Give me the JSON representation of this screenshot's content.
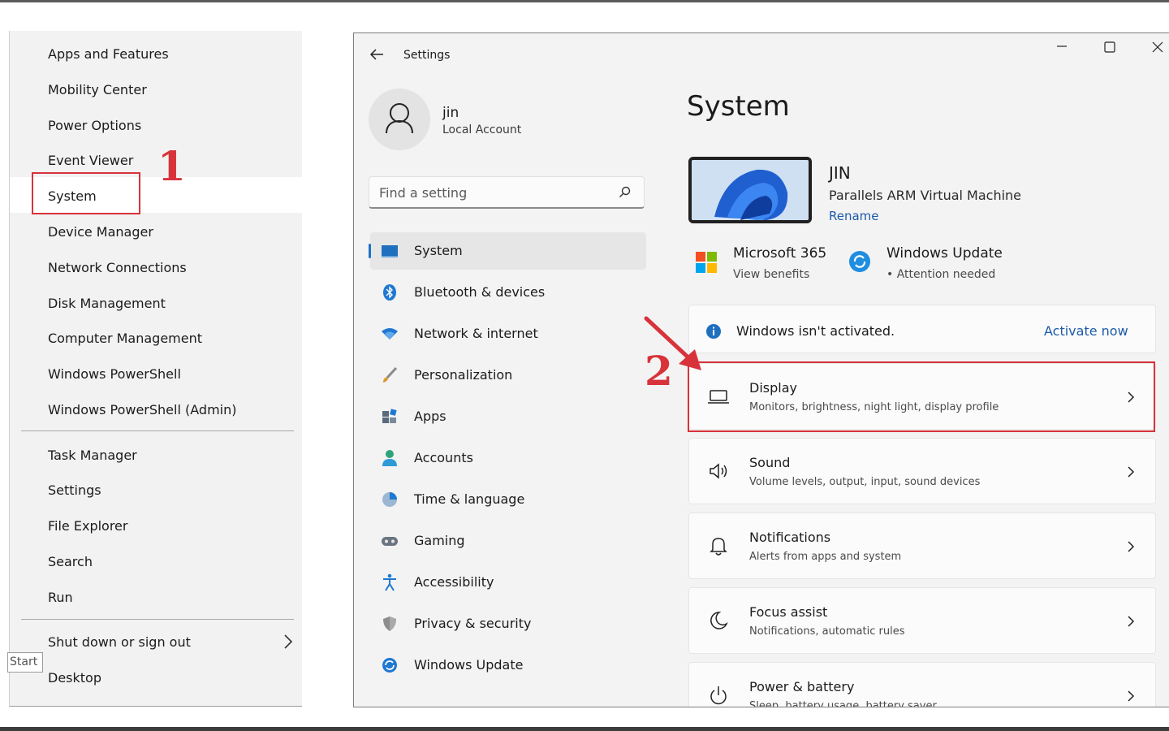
{
  "winx_menu": {
    "items": [
      "Apps and Features",
      "Mobility Center",
      "Power Options",
      "Event Viewer",
      "System",
      "Device Manager",
      "Network Connections",
      "Disk Management",
      "Computer Management",
      "Windows PowerShell",
      "Windows PowerShell (Admin)",
      "Task Manager",
      "Settings",
      "File Explorer",
      "Search",
      "Run",
      "Shut down or sign out",
      "Desktop"
    ],
    "highlighted": "System",
    "start_tooltip": "Start"
  },
  "annotations": {
    "step1": "1",
    "step2": "2",
    "color": "#d8323a"
  },
  "settings": {
    "window_title": "Settings",
    "user": {
      "name": "jin",
      "account_type": "Local Account"
    },
    "search": {
      "placeholder": "Find a setting"
    },
    "nav": [
      {
        "label": "System",
        "icon": "monitor-icon",
        "selected": true
      },
      {
        "label": "Bluetooth & devices",
        "icon": "bluetooth-icon"
      },
      {
        "label": "Network & internet",
        "icon": "wifi-icon"
      },
      {
        "label": "Personalization",
        "icon": "brush-icon"
      },
      {
        "label": "Apps",
        "icon": "apps-icon"
      },
      {
        "label": "Accounts",
        "icon": "person-icon"
      },
      {
        "label": "Time & language",
        "icon": "globe-clock-icon"
      },
      {
        "label": "Gaming",
        "icon": "gamepad-icon"
      },
      {
        "label": "Accessibility",
        "icon": "accessibility-icon"
      },
      {
        "label": "Privacy & security",
        "icon": "shield-icon"
      },
      {
        "label": "Windows Update",
        "icon": "update-icon"
      }
    ],
    "page_title": "System",
    "device": {
      "name": "JIN",
      "model": "Parallels ARM Virtual Machine",
      "rename": "Rename"
    },
    "quick_links": [
      {
        "title": "Microsoft 365",
        "subtitle": "View benefits",
        "icon": "microsoft-logo-icon"
      },
      {
        "title": "Windows Update",
        "subtitle": "• Attention needed",
        "icon": "update-icon"
      }
    ],
    "activation": {
      "text": "Windows isn't activated.",
      "action": "Activate now"
    },
    "cards": [
      {
        "title": "Display",
        "subtitle": "Monitors, brightness, night light, display profile",
        "icon": "display-icon"
      },
      {
        "title": "Sound",
        "subtitle": "Volume levels, output, input, sound devices",
        "icon": "speaker-icon"
      },
      {
        "title": "Notifications",
        "subtitle": "Alerts from apps and system",
        "icon": "bell-icon"
      },
      {
        "title": "Focus assist",
        "subtitle": "Notifications, automatic rules",
        "icon": "moon-icon"
      },
      {
        "title": "Power & battery",
        "subtitle": "Sleep, battery usage, battery saver",
        "icon": "power-icon"
      }
    ],
    "colors": {
      "accent": "#1a73c8",
      "link": "#1c5aa8",
      "highlight_box": "#d8323a"
    }
  }
}
